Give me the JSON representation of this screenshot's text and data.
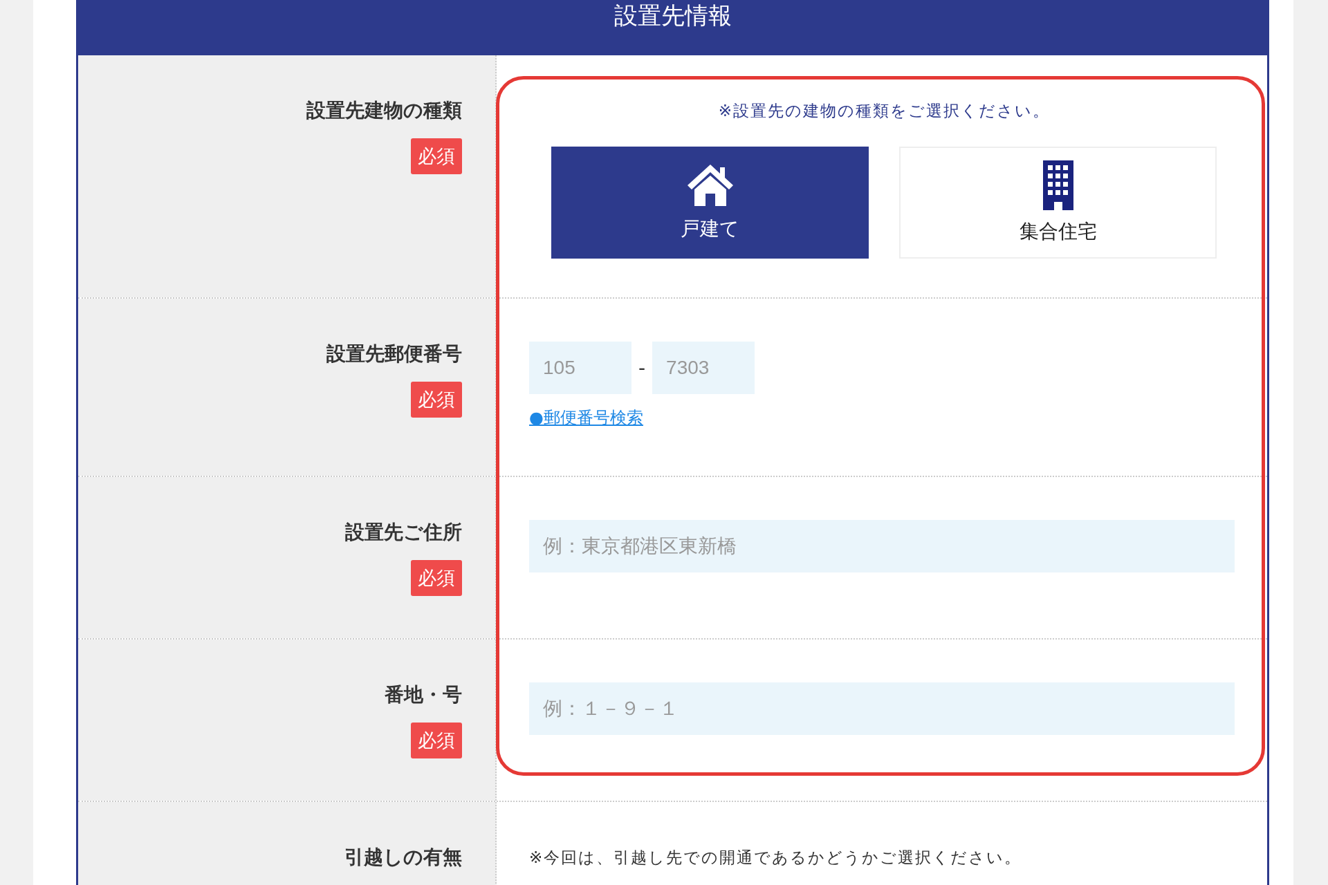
{
  "section": {
    "title": "設置先情報"
  },
  "rows": [
    {
      "kind": "building",
      "label": "設置先建物の種類",
      "required": true,
      "badge": "必須",
      "note": "※設置先の建物の種類をご選択ください。",
      "options": [
        {
          "kind": "house",
          "label": "戸建て",
          "selected": true
        },
        {
          "kind": "apartment",
          "label": "集合住宅",
          "selected": false
        }
      ]
    },
    {
      "kind": "postal",
      "label": "設置先郵便番号",
      "required": true,
      "badge": "必須",
      "first": {
        "placeholder": "105"
      },
      "separator": "-",
      "second": {
        "placeholder": "7303"
      },
      "link": "●郵便番号検索"
    },
    {
      "kind": "text",
      "label": "設置先ご住所",
      "required": true,
      "badge": "必須",
      "placeholder": "例：東京都港区東新橋"
    },
    {
      "kind": "text",
      "label": "番地・号",
      "required": true,
      "badge": "必須",
      "placeholder": "例：１－９－１"
    },
    {
      "kind": "note",
      "label": "引越しの有無",
      "note": "※今回は、引越し先での開通であるかどうかご選択ください。"
    }
  ]
}
